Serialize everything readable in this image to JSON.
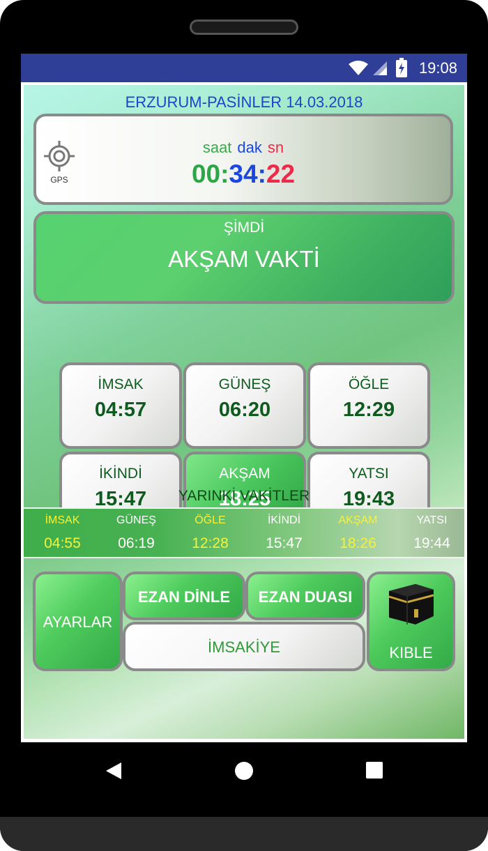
{
  "status_bar": {
    "time": "19:08",
    "icons": [
      "wifi-icon",
      "cell-signal-icon",
      "battery-charging-icon"
    ]
  },
  "location_date": "ERZURUM-PASİNLER 14.03.2018",
  "timer": {
    "gps_label": "GPS",
    "unit_hour": "saat",
    "unit_min": "dak",
    "unit_sec": "sn",
    "hours": "00",
    "minutes": "34",
    "seconds": "22",
    "separator": ":"
  },
  "now": {
    "label": "ŞİMDİ",
    "value": "AKŞAM VAKTİ"
  },
  "today_times": [
    {
      "name": "İMSAK",
      "time": "04:57"
    },
    {
      "name": "GÜNEŞ",
      "time": "06:20"
    },
    {
      "name": "ÖĞLE",
      "time": "12:29"
    },
    {
      "name": "İKİNDİ",
      "time": "15:47"
    },
    {
      "name": "AKŞAM",
      "time": "18:25"
    },
    {
      "name": "YATSI",
      "time": "19:43"
    }
  ],
  "tomorrow": {
    "title": "YARINKİ VAKİTLER",
    "items": [
      {
        "name": "İMSAK",
        "time": "04:55"
      },
      {
        "name": "GÜNEŞ",
        "time": "06:19"
      },
      {
        "name": "ÖĞLE",
        "time": "12:28"
      },
      {
        "name": "İKİNDİ",
        "time": "15:47"
      },
      {
        "name": "AKŞAM",
        "time": "18:26"
      },
      {
        "name": "YATSI",
        "time": "19:44"
      }
    ]
  },
  "buttons": {
    "settings": "AYARLAR",
    "ezan_listen": "EZAN DİNLE",
    "ezan_prayer": "EZAN DUASI",
    "imsakiye": "İMSAKİYE",
    "qibla": "KIBLE"
  },
  "colors": {
    "status_bar": "#2f3f98",
    "location_text": "#1a47c8",
    "hour_green": "#2aa845",
    "minute_blue": "#1a47e0",
    "second_red": "#ee2a4a",
    "card_text": "#0f5a1f",
    "tomorrow_yellow": "#f6f23a"
  }
}
